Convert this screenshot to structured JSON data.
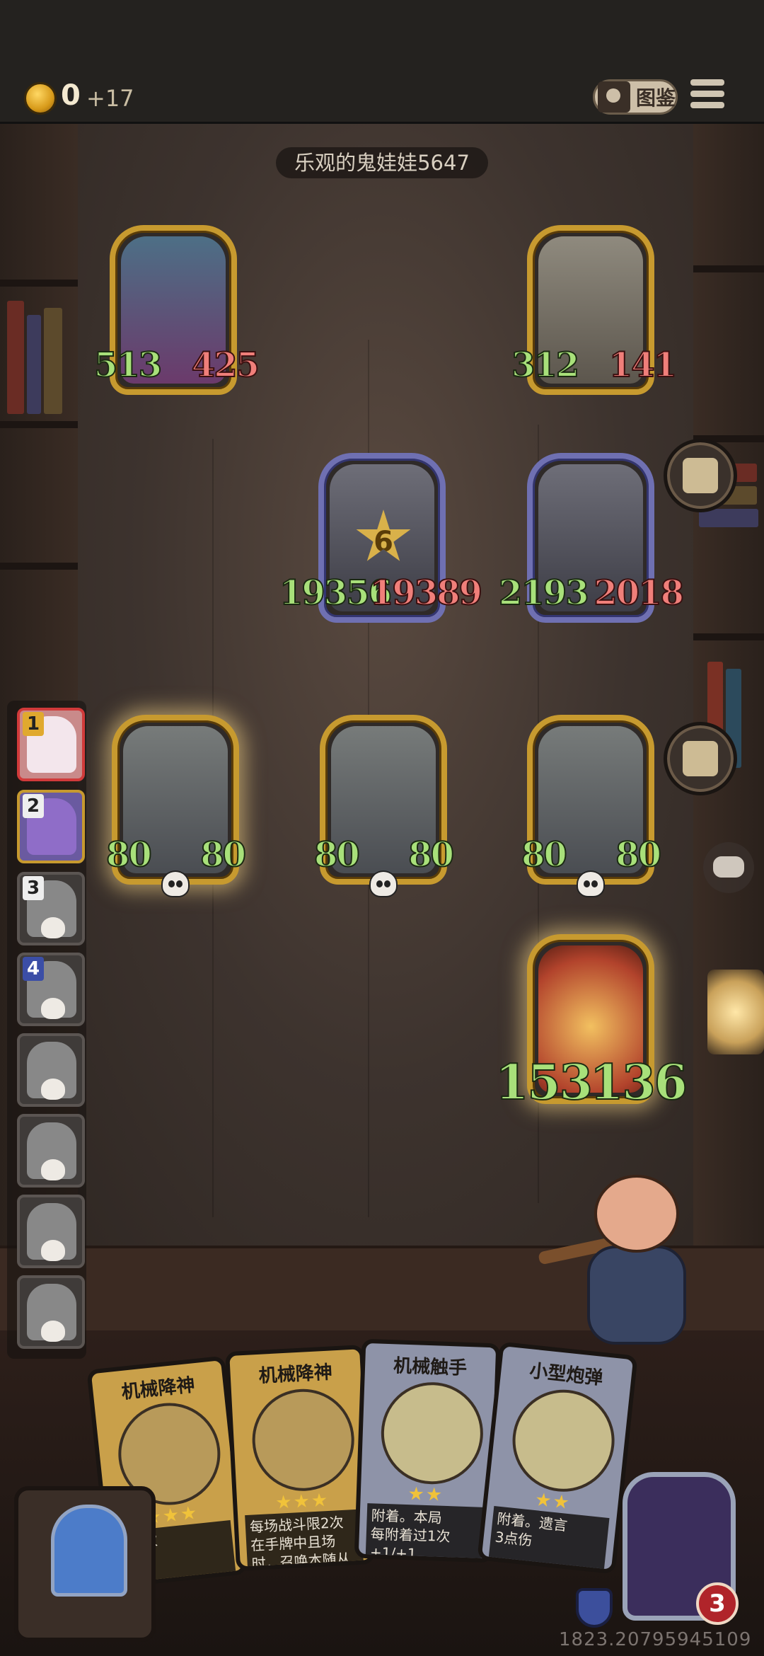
{
  "top_bar": {
    "coins": "0",
    "coins_income": "+17",
    "collection_label": "图鉴"
  },
  "opponent": {
    "name": "乐观的鬼娃娃5647"
  },
  "board": {
    "enemy_back": [
      {
        "name": "elf-sorceress",
        "attack": "513",
        "health": "425"
      },
      {
        "name": "windmill",
        "attack": "312",
        "health": "141"
      }
    ],
    "enemy_front": [
      {
        "name": "mech-shark",
        "attack": "19356",
        "health": "19389",
        "star_badge": "6"
      },
      {
        "name": "mech-shark",
        "attack": "2193",
        "health": "2018"
      }
    ],
    "player": [
      {
        "name": "bell-robot",
        "attack": "80",
        "health": "80"
      },
      {
        "name": "bell-robot",
        "attack": "80",
        "health": "80"
      },
      {
        "name": "bell-robot",
        "attack": "80",
        "health": "80"
      }
    ],
    "summon": {
      "name": "clown",
      "attack": "153",
      "health": "136"
    }
  },
  "roster": [
    {
      "rank": "1",
      "state": "active"
    },
    {
      "rank": "2",
      "state": "alive"
    },
    {
      "rank": "3",
      "state": "dead"
    },
    {
      "rank": "4",
      "state": "dead"
    },
    {
      "rank": "",
      "state": "dead"
    },
    {
      "rank": "",
      "state": "dead"
    },
    {
      "rank": "",
      "state": "dead"
    },
    {
      "rank": "",
      "state": "dead"
    }
  ],
  "hand": [
    {
      "title": "机械降神",
      "stars": "★★★",
      "desc": "限2次\n且场"
    },
    {
      "title": "机械降神",
      "stars": "★★★",
      "desc": "每场战斗限2次\n在手牌中且场\n时，召唤本随从"
    },
    {
      "title": "机械触手",
      "stars": "★★",
      "desc": "附着。本局\n每附着过1次\n+1/+1"
    },
    {
      "title": "小型炮弹",
      "stars": "★★",
      "desc": "附着。遗言\n3点伤"
    }
  ],
  "player": {
    "health": "3"
  },
  "timer_text": "1823.20795945109",
  "colors": {
    "gold_frame": "#c79a2f",
    "purple_frame": "#6f70b2",
    "attack_green": "#a8e07a",
    "health_red": "#f07f7a"
  }
}
